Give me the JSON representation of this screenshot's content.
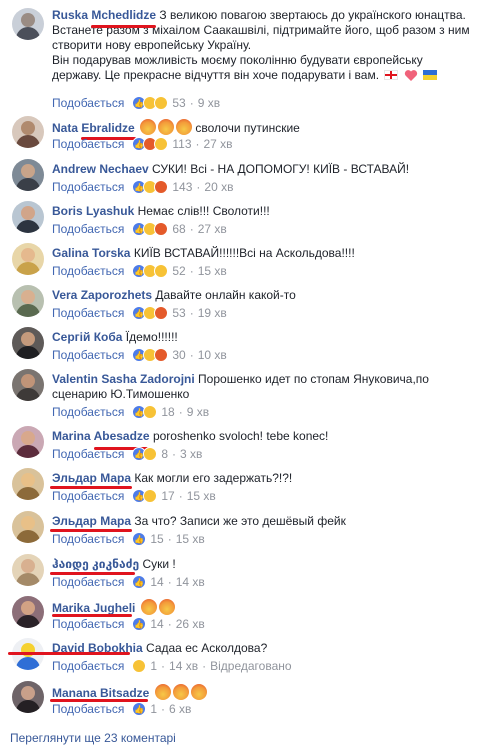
{
  "actions": {
    "like": "Подобається",
    "reply_separator": "·"
  },
  "colors": {
    "link": "#385898",
    "meta": "#90949c",
    "underline": "#e0141e"
  },
  "comments": [
    {
      "author": "Ruska Mchedlidze",
      "text_lines": [
        "З великою повагою звертаюсь до українского юнацтва.",
        "Встанете разом з міхаілом Саакашвілі, підтримайте його, щоб разом з ним",
        "створити нову европейську Україну.",
        "Він подарував можливість моєму поколінню будувати європейську",
        "державу. Це прекрасне відчуття він хоче подарувати і вам."
      ],
      "reactions": [
        "like",
        "haha",
        "wow"
      ],
      "count": "53",
      "time": "9 хв"
    },
    {
      "author": "Nata Ebralidze",
      "text_lines": [
        "сволочи путинские"
      ],
      "reactions": [
        "like",
        "angry",
        "haha"
      ],
      "count": "113",
      "time": "27 хв"
    },
    {
      "author": "Andrew Nechaev",
      "text_lines": [
        "СУКИ! Всі - НА ДОПОМОГУ! КИЇВ - ВСТАВАЙ!"
      ],
      "reactions": [
        "like",
        "haha",
        "angry"
      ],
      "count": "143",
      "time": "20 хв"
    },
    {
      "author": "Boris Lyashuk",
      "text_lines": [
        "Немає слів!!! Сволоти!!!"
      ],
      "reactions": [
        "like",
        "haha",
        "angry"
      ],
      "count": "68",
      "time": "27 хв"
    },
    {
      "author": "Galina Torska",
      "text_lines": [
        "КИЇВ ВСТАВАЙ!!!!!!Всі на Аскольдова!!!!"
      ],
      "reactions": [
        "like",
        "haha",
        "wow"
      ],
      "count": "52",
      "time": "15 хв"
    },
    {
      "author": "Vera Zaporozhets",
      "text_lines": [
        "Давайте онлайн какой-то"
      ],
      "reactions": [
        "like",
        "haha",
        "angry"
      ],
      "count": "53",
      "time": "19 хв"
    },
    {
      "author": "Сергій Коба",
      "text_lines": [
        "Їдемо!!!!!!"
      ],
      "reactions": [
        "like",
        "haha",
        "angry"
      ],
      "count": "30",
      "time": "10 хв"
    },
    {
      "author": "Valentin Sasha Zadorojni",
      "text_lines": [
        "Порошенко идет по стопам Януковича,по",
        "сценарию Ю.Тимошенко"
      ],
      "reactions": [
        "like",
        "haha"
      ],
      "count": "18",
      "time": "9 хв"
    },
    {
      "author": "Marina Abesadze",
      "text_lines": [
        "poroshenko svoloch! tebe konec!"
      ],
      "reactions": [
        "like",
        "haha"
      ],
      "count": "8",
      "time": "3 хв"
    },
    {
      "author": "Эльдар Мара",
      "text_lines": [
        "Как могли его задержать?!?!"
      ],
      "reactions": [
        "like",
        "wow"
      ],
      "count": "17",
      "time": "15 хв"
    },
    {
      "author": "Эльдар Мара",
      "text_lines": [
        "За что? Записи же это дешёвый фейк"
      ],
      "reactions": [
        "like"
      ],
      "count": "15",
      "time": "15 хв"
    },
    {
      "author": "ჰაიდე კიკნაძე",
      "text_lines": [
        "Суки !"
      ],
      "reactions": [
        "like"
      ],
      "count": "14",
      "time": "14 хв"
    },
    {
      "author": "Marika Jugheli",
      "text_lines": [
        ""
      ],
      "reactions": [
        "like"
      ],
      "count": "14",
      "time": "26 хв"
    },
    {
      "author": "David Bobokhia",
      "text_lines": [
        "Садаа ес Асколдова?"
      ],
      "reactions": [
        "sad"
      ],
      "count": "1",
      "time": "14 хв",
      "edited": "Відредаговано"
    },
    {
      "author": "Manana Bitsadze",
      "text_lines": [
        ""
      ],
      "reactions": [
        "like"
      ],
      "count": "1",
      "time": "6 хв"
    }
  ],
  "footer": {
    "more_comments": "Переглянути ще 23 коментарі"
  }
}
